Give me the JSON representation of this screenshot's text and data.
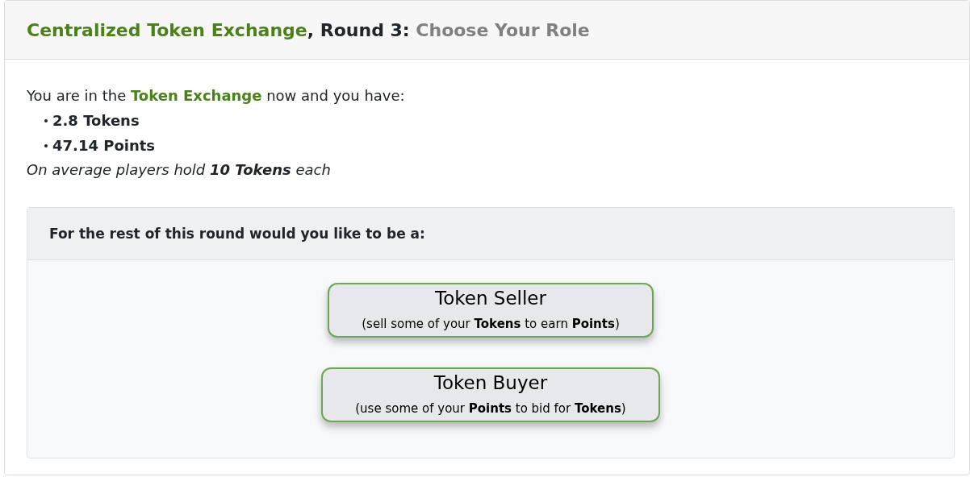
{
  "header": {
    "title_parts": [
      {
        "kind": "game",
        "text": "Centralized Token Exchange"
      },
      {
        "kind": "plain",
        "text": ", Round 3: "
      },
      {
        "kind": "step",
        "text": "Choose Your Role"
      }
    ]
  },
  "intro": "You are in the **Token Exchange** now and you have:",
  "holdings": [
    "2.8 Tokens",
    "47.14 Points"
  ],
  "average_note": "On average players hold **10 Tokens** each",
  "role_panel": {
    "question": "For the rest of this round would you like to be a:",
    "roles": [
      {
        "title": "Token Seller",
        "description": "(sell some of your **Tokens** to earn **Points**)"
      },
      {
        "title": "Token Buyer",
        "description": "(use some of your **Points** to bid for **Tokens**)"
      }
    ]
  }
}
